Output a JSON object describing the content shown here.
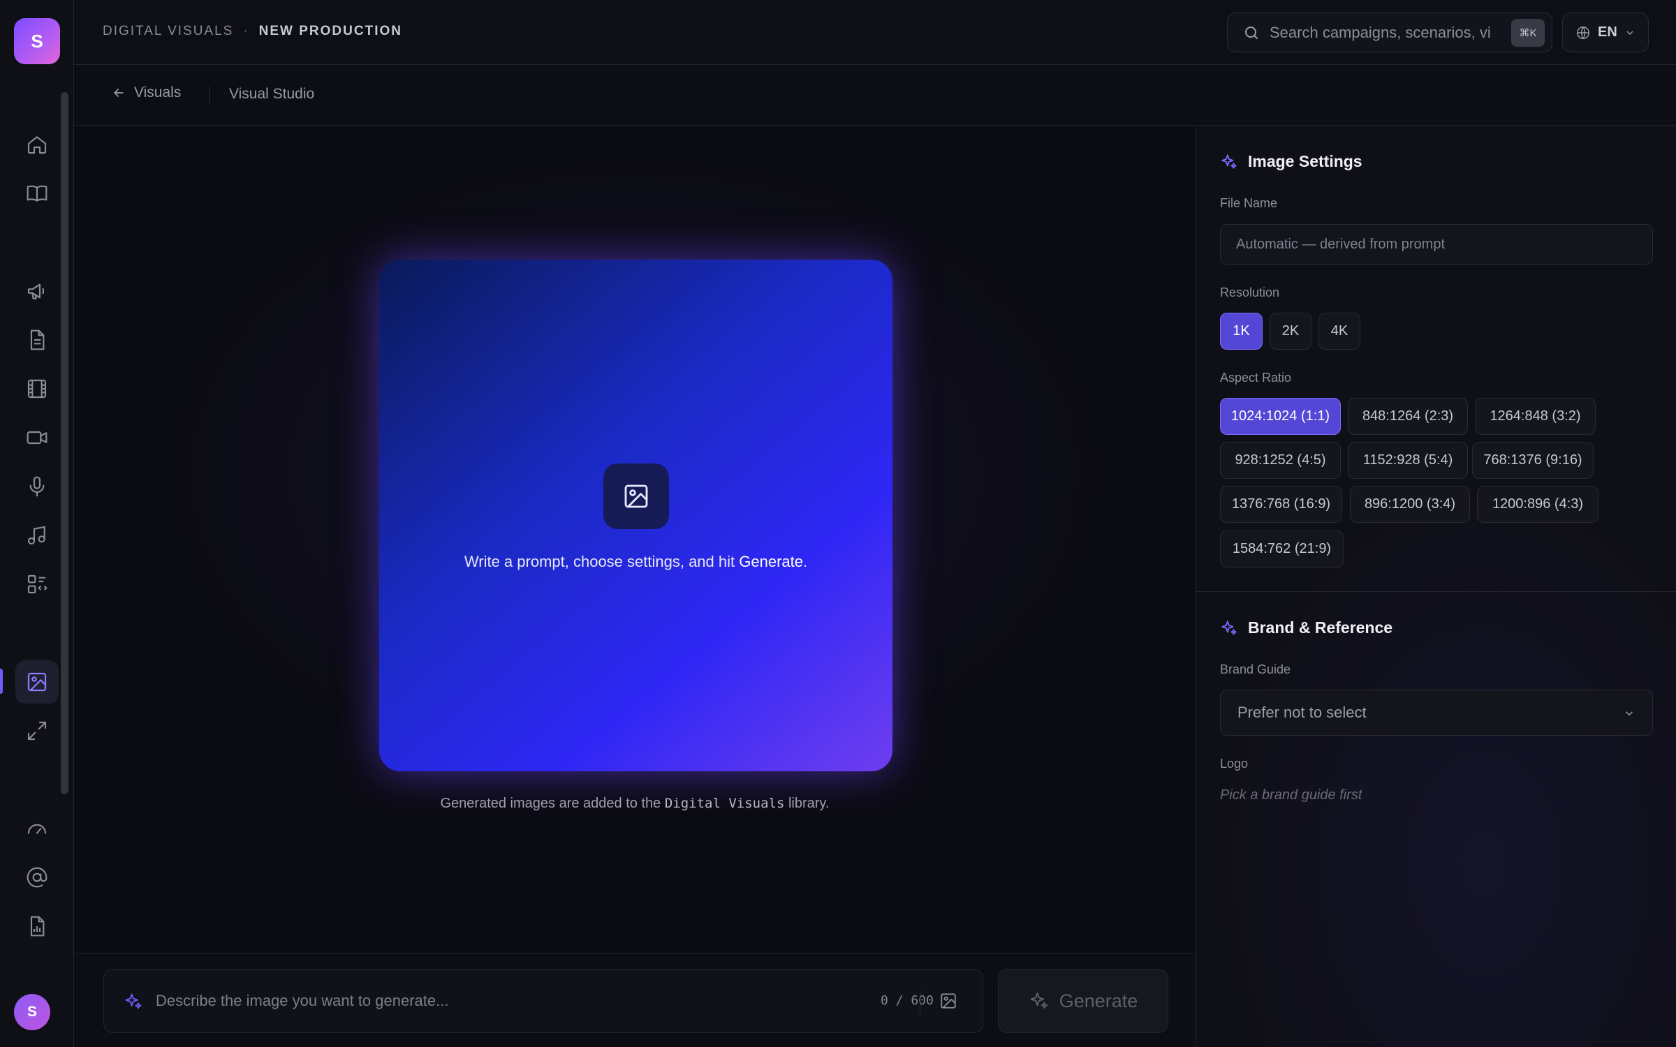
{
  "rail": {
    "logo_letter": "S",
    "avatar_letter": "S",
    "icons": [
      "home-icon",
      "book-icon",
      "megaphone-icon",
      "document-icon",
      "film-icon",
      "video-camera-icon",
      "microphone-icon",
      "music-note-icon",
      "apps-icon",
      "image-icon",
      "expand-icon",
      "gauge-icon",
      "at-sign-icon",
      "report-icon"
    ],
    "active": "image-icon"
  },
  "header": {
    "crumb_section": "Digital Visuals",
    "crumb_separator": "·",
    "crumb_page": "New Production",
    "search_placeholder": "Search campaigns, scenarios, vi",
    "search_shortcut": "⌘K",
    "language": "EN"
  },
  "subheader": {
    "back_label": "Visuals",
    "studio_label": "Visual Studio"
  },
  "canvas": {
    "hint_prefix": "Write a prompt, choose settings, and hit ",
    "hint_action": "Generate",
    "hint_suffix": ".",
    "library_prefix": "Generated images are added to the ",
    "library_name": "Digital Visuals",
    "library_suffix": " library."
  },
  "prompt": {
    "placeholder": "Describe the image you want to generate...",
    "counter": "0 / 600",
    "generate_label": "Generate"
  },
  "settings": {
    "title": "Image Settings",
    "file_name_label": "File Name",
    "file_name_placeholder": "Automatic — derived from prompt",
    "resolution_label": "Resolution",
    "resolutions": [
      "1K",
      "2K",
      "4K"
    ],
    "resolution_selected": "1K",
    "aspect_label": "Aspect Ratio",
    "aspect_ratios": [
      "1024:1024 (1:1)",
      "848:1264 (2:3)",
      "1264:848 (3:2)",
      "928:1252 (4:5)",
      "1152:928 (5:4)",
      "768:1376 (9:16)",
      "1376:768 (16:9)",
      "896:1200 (3:4)",
      "1200:896 (4:3)",
      "1584:762 (21:9)"
    ],
    "aspect_selected": "1024:1024 (1:1)"
  },
  "brand": {
    "title": "Brand & Reference",
    "guide_label": "Brand Guide",
    "guide_value": "Prefer not to select",
    "logo_label": "Logo",
    "logo_hint": "Pick a brand guide first"
  },
  "colors": {
    "accent": "#5447d6",
    "accent_light": "#7c6cff",
    "background": "#0b0b12"
  }
}
